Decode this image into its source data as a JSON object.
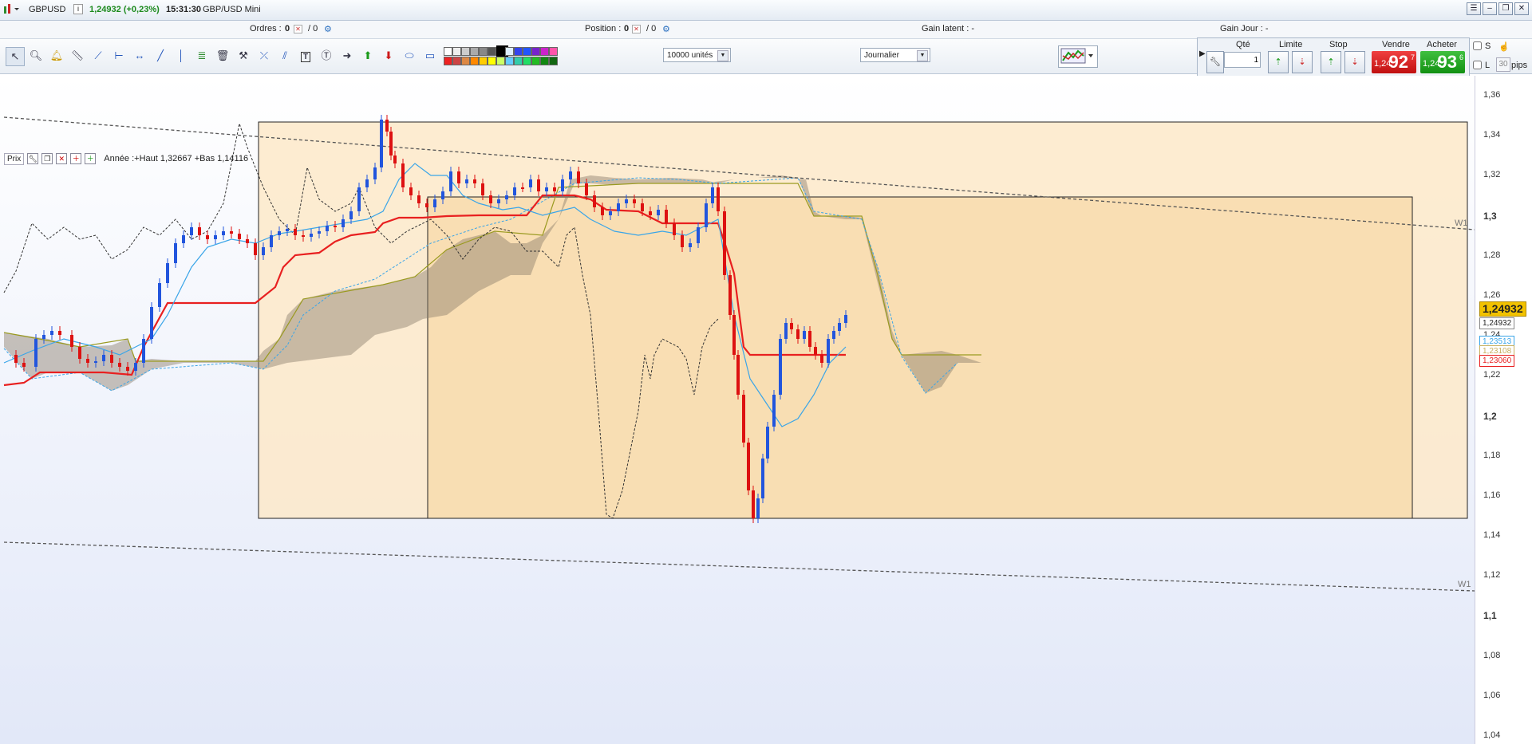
{
  "titlebar": {
    "symbol": "GBPUSD",
    "price_change": "1,24932 (+0,23%)",
    "time": "15:31:30",
    "instrument": "GBP/USD Mini"
  },
  "infobar": {
    "orders_label": "Ordres :",
    "orders_value": "0",
    "orders_sep": "/ 0",
    "position_label": "Position :",
    "position_value": "0",
    "position_sep": "/ 0",
    "gain_latent": "Gain latent : -",
    "gain_jour": "Gain Jour : -"
  },
  "toolbar": {
    "units": "10000 unités",
    "period": "Journalier"
  },
  "order_panel": {
    "qte_label": "Qté",
    "qte_value": "1",
    "limite_label": "Limite",
    "stop_label": "Stop",
    "vendre_label": "Vendre",
    "acheter_label": "Acheter",
    "sell_small": "1,24",
    "sell_big": "92",
    "sell_sup": "7",
    "buy_small": "1,24",
    "buy_big": "93",
    "buy_sup": "6",
    "s_label": "S",
    "l_label": "L",
    "pips_value": "30",
    "pips_label": "pips"
  },
  "legend": {
    "prix": "Prix",
    "annee": "Année :+Haut 1,32667 +Bas 1,14116"
  },
  "chart_data": {
    "type": "candlestick",
    "y_ticks": [
      "1,36",
      "1,34",
      "1,32",
      "1,3",
      "1,28",
      "1,26",
      "1,24",
      "1,22",
      "1,2",
      "1,18",
      "1,16",
      "1,14",
      "1,12",
      "1,1",
      "1,08",
      "1,06",
      "1,04"
    ],
    "ylim": [
      1.04,
      1.36
    ],
    "price_tags": [
      {
        "value": "1,24932",
        "color": "#f2c200"
      },
      {
        "value": "1,24932",
        "color": "#ffffff"
      },
      {
        "value": "1,23513",
        "color": "#3aa5e8"
      },
      {
        "value": "1,23108",
        "color": "#c8b060"
      },
      {
        "value": "1,23060",
        "color": "#e82020"
      }
    ],
    "trendline_labels": [
      "W1",
      "W1"
    ]
  }
}
